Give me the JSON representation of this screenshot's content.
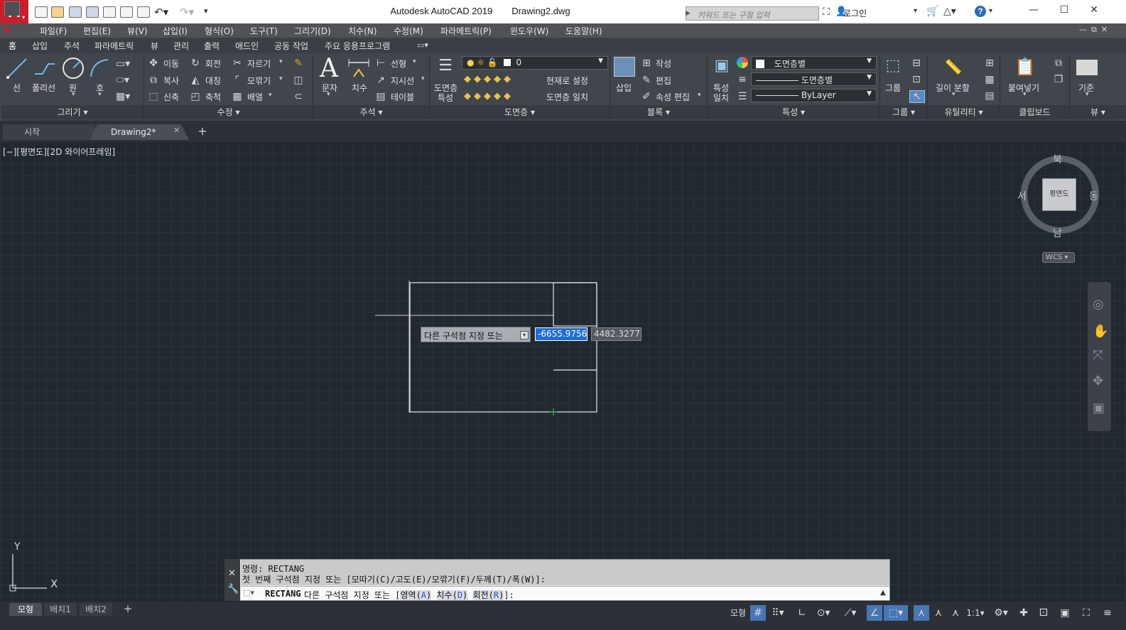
{
  "title": {
    "app_name": "Autodesk AutoCAD 2019",
    "file_name": "Drawing2.dwg",
    "search_placeholder": "키워드 또는 구절 입력",
    "login": "로그인",
    "logo": "A"
  },
  "menu": [
    "파일(F)",
    "편집(E)",
    "뷰(V)",
    "삽입(I)",
    "형식(O)",
    "도구(T)",
    "그리기(D)",
    "치수(N)",
    "수정(M)",
    "파라메트릭(P)",
    "윈도우(W)",
    "도움말(H)"
  ],
  "ribbon_tabs": [
    "홈",
    "삽입",
    "주석",
    "파라메트릭",
    "뷰",
    "관리",
    "출력",
    "애드인",
    "공동 작업",
    "주요 응용프로그램"
  ],
  "ribbon": {
    "draw": {
      "line": "선",
      "polyline": "폴리선",
      "circle": "원",
      "arc": "호"
    },
    "modify": {
      "move": "이동",
      "rotate": "회전",
      "trim": "자르기",
      "copy": "복사",
      "mirror": "대칭",
      "fillet": "모깎기",
      "stretch": "신축",
      "scale": "축척",
      "array": "배열"
    },
    "annotation": {
      "text": "문자",
      "dimension": "치수",
      "linear": "선형",
      "leader": "지시선",
      "table": "테이블"
    },
    "layers": {
      "layer_properties_1": "도면층",
      "layer_properties_2": "특성",
      "layer_name": "0",
      "set_current": "현재로 설정",
      "match_layer": "도면층 일치"
    },
    "block": {
      "insert": "삽입",
      "create": "작성",
      "edit": "편집",
      "edit_attributes": "속성 편집"
    },
    "properties": {
      "match_1": "특성",
      "match_2": "일치",
      "color": "도면층별",
      "linetype": "도면층별",
      "lineweight": "ByLayer"
    },
    "groups": {
      "group": "그룹"
    },
    "utilities": {
      "measure": "길이 분할"
    },
    "clipboard": {
      "paste": "붙여넣기"
    },
    "view": {
      "base": "기준"
    },
    "panel_titles": {
      "draw": "그리기",
      "modify": "수정",
      "annotation": "주석",
      "layers": "도면층",
      "block": "블록",
      "properties": "특성",
      "groups": "그룹",
      "utilities": "유틸리티",
      "clipboard": "클립보드",
      "view": "뷰"
    }
  },
  "file_tabs": {
    "start": "시작",
    "drawing": "Drawing2*"
  },
  "viewport": {
    "label": "[−][평면도][2D 와이어프레임]",
    "viewcube": {
      "north": "북",
      "south": "남",
      "east": "동",
      "west": "서",
      "face": "평면도",
      "wcs": "WCS"
    },
    "ucs": {
      "x": "X",
      "y": "Y"
    }
  },
  "dynamic_input": {
    "prompt": "다른 구석점 지정 또는",
    "x_value": "-6655.9756",
    "y_value": "4482.3277"
  },
  "command_line": {
    "history_1": "명령: RECTANG",
    "history_2": "첫 번째 구석점 지정 또는 [모따기(C)/고도(E)/모깎기(F)/두께(T)/폭(W)]:",
    "current_cmd": "RECTANG",
    "current_prompt": "다른 구석점 지정 또는 [",
    "opt_area": "영역(",
    "opt_area_key": "A",
    "opt_dim": "치수(",
    "opt_dim_key": "D",
    "opt_rotate": "회전(",
    "opt_rotate_key": "R",
    "tail": "]:"
  },
  "layout_tabs": [
    "모형",
    "배치1",
    "배치2"
  ],
  "status": {
    "model": "모형",
    "scale": "1:1"
  }
}
